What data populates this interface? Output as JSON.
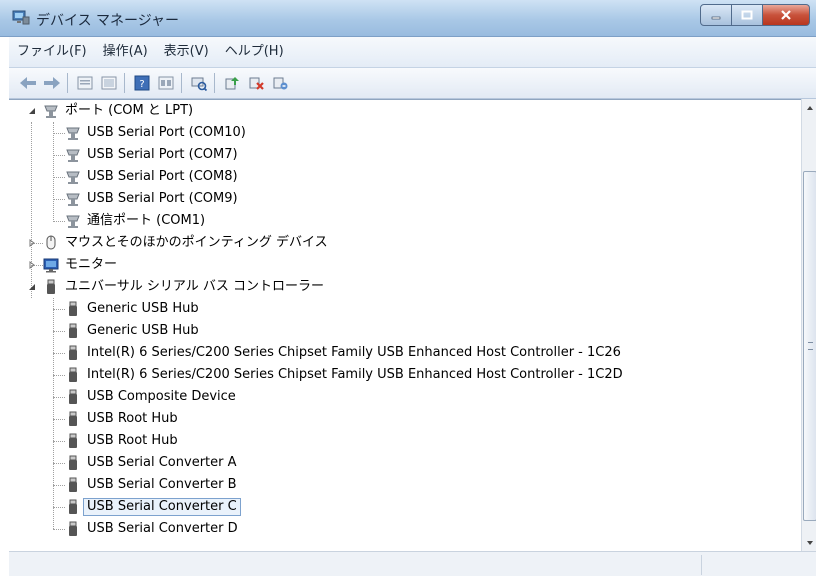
{
  "window": {
    "title": "デバイス マネージャー"
  },
  "menu": [
    "ファイル(F)",
    "操作(A)",
    "表示(V)",
    "ヘルプ(H)"
  ],
  "toolbar": [
    "back-icon",
    "forward-icon",
    "properties-view-icon",
    "show-hidden-icon",
    "help-icon",
    "details-view-icon",
    "scan-hardware-icon",
    "update-driver-icon",
    "disable-device-icon",
    "uninstall-device-icon"
  ],
  "tree": {
    "ports": {
      "label": "ポート (COM と LPT)",
      "children": [
        "USB Serial Port (COM10)",
        "USB Serial Port (COM7)",
        "USB Serial Port (COM8)",
        "USB Serial Port (COM9)",
        "通信ポート (COM1)"
      ]
    },
    "mouse": {
      "label": "マウスとそのほかのポインティング デバイス"
    },
    "monitor": {
      "label": "モニター"
    },
    "usb": {
      "label": "ユニバーサル シリアル バス コントローラー",
      "children": [
        "Generic USB Hub",
        "Generic USB Hub",
        "Intel(R) 6 Series/C200 Series Chipset Family USB Enhanced Host Controller - 1C26",
        "Intel(R) 6 Series/C200 Series Chipset Family USB Enhanced Host Controller - 1C2D",
        "USB Composite Device",
        "USB Root Hub",
        "USB Root Hub",
        "USB Serial Converter A",
        "USB Serial Converter B",
        "USB Serial Converter C",
        "USB Serial Converter D"
      ],
      "selected": "USB Serial Converter C"
    }
  },
  "colors": {
    "selection_border": "#7da2ce",
    "selection_fill": "#eaf2fb",
    "title_gradient": "#a9c8e6"
  }
}
